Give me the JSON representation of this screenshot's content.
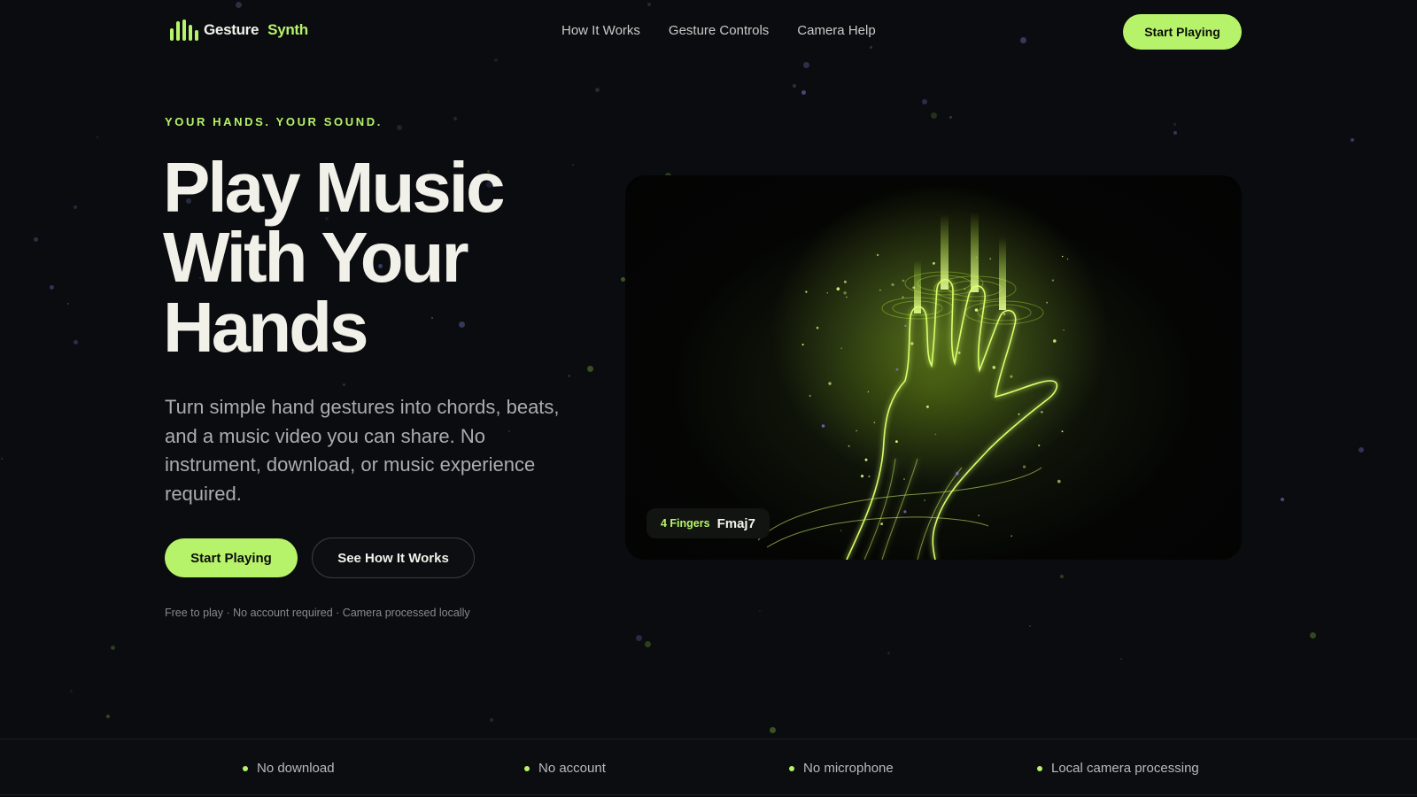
{
  "brand": {
    "name_part1": "Gesture",
    "name_part2": "Synth",
    "accent": "#b7f36a",
    "icon": "sound-bars-icon"
  },
  "nav": {
    "links": [
      "How It Works",
      "Gesture Controls",
      "Camera Help"
    ],
    "cta": "Start Playing"
  },
  "hero": {
    "eyebrow": "YOUR HANDS. YOUR SOUND.",
    "headline": [
      "Play Music",
      "With Your",
      "Hands"
    ],
    "lede": "Turn simple hand gestures into chords, beats, and a music video you can share. No instrument, download, or music experience required.",
    "primary_cta": "Start Playing",
    "secondary_cta": "See How It Works",
    "fineprint": "Free to play · No account required · Camera processed locally"
  },
  "visual": {
    "image": "glowing-hand-illustration",
    "badge": {
      "fingers": "4 Fingers",
      "chord": "Fmaj7"
    }
  },
  "features": [
    "No download",
    "No account",
    "No microphone",
    "Local camera processing"
  ],
  "colors": {
    "background": "#0a0c0f",
    "accent": "#b7f36a",
    "text": "#f1f1ea",
    "muted": "#a9adb0"
  }
}
